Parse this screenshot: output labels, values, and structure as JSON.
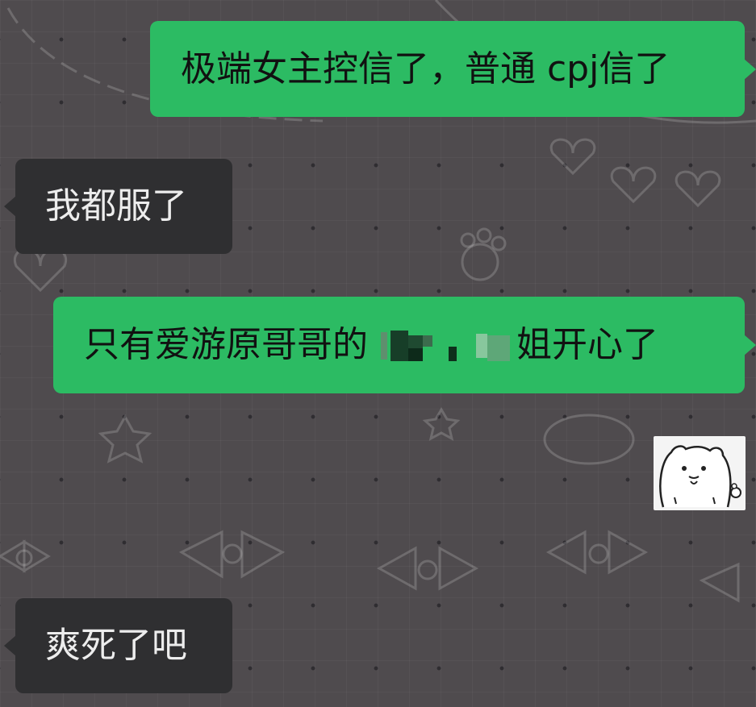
{
  "chat": {
    "messages": [
      {
        "side": "right",
        "text": "极端女主控信了，普通 cpj信了"
      },
      {
        "side": "left",
        "text": "我都服了"
      },
      {
        "side": "right",
        "text_before": "只有爱游原哥哥的",
        "text_after": "姐开心了",
        "has_redaction": true
      },
      {
        "side": "right",
        "type": "sticker",
        "sticker_name": "bear-meme-sticker"
      },
      {
        "side": "left",
        "text": "爽死了吧"
      }
    ]
  },
  "colors": {
    "background": "#4f4b4e",
    "outgoing_bubble": "#2cbb63",
    "incoming_bubble": "#2f2f31",
    "incoming_text": "#ededed",
    "outgoing_text": "#111111"
  }
}
